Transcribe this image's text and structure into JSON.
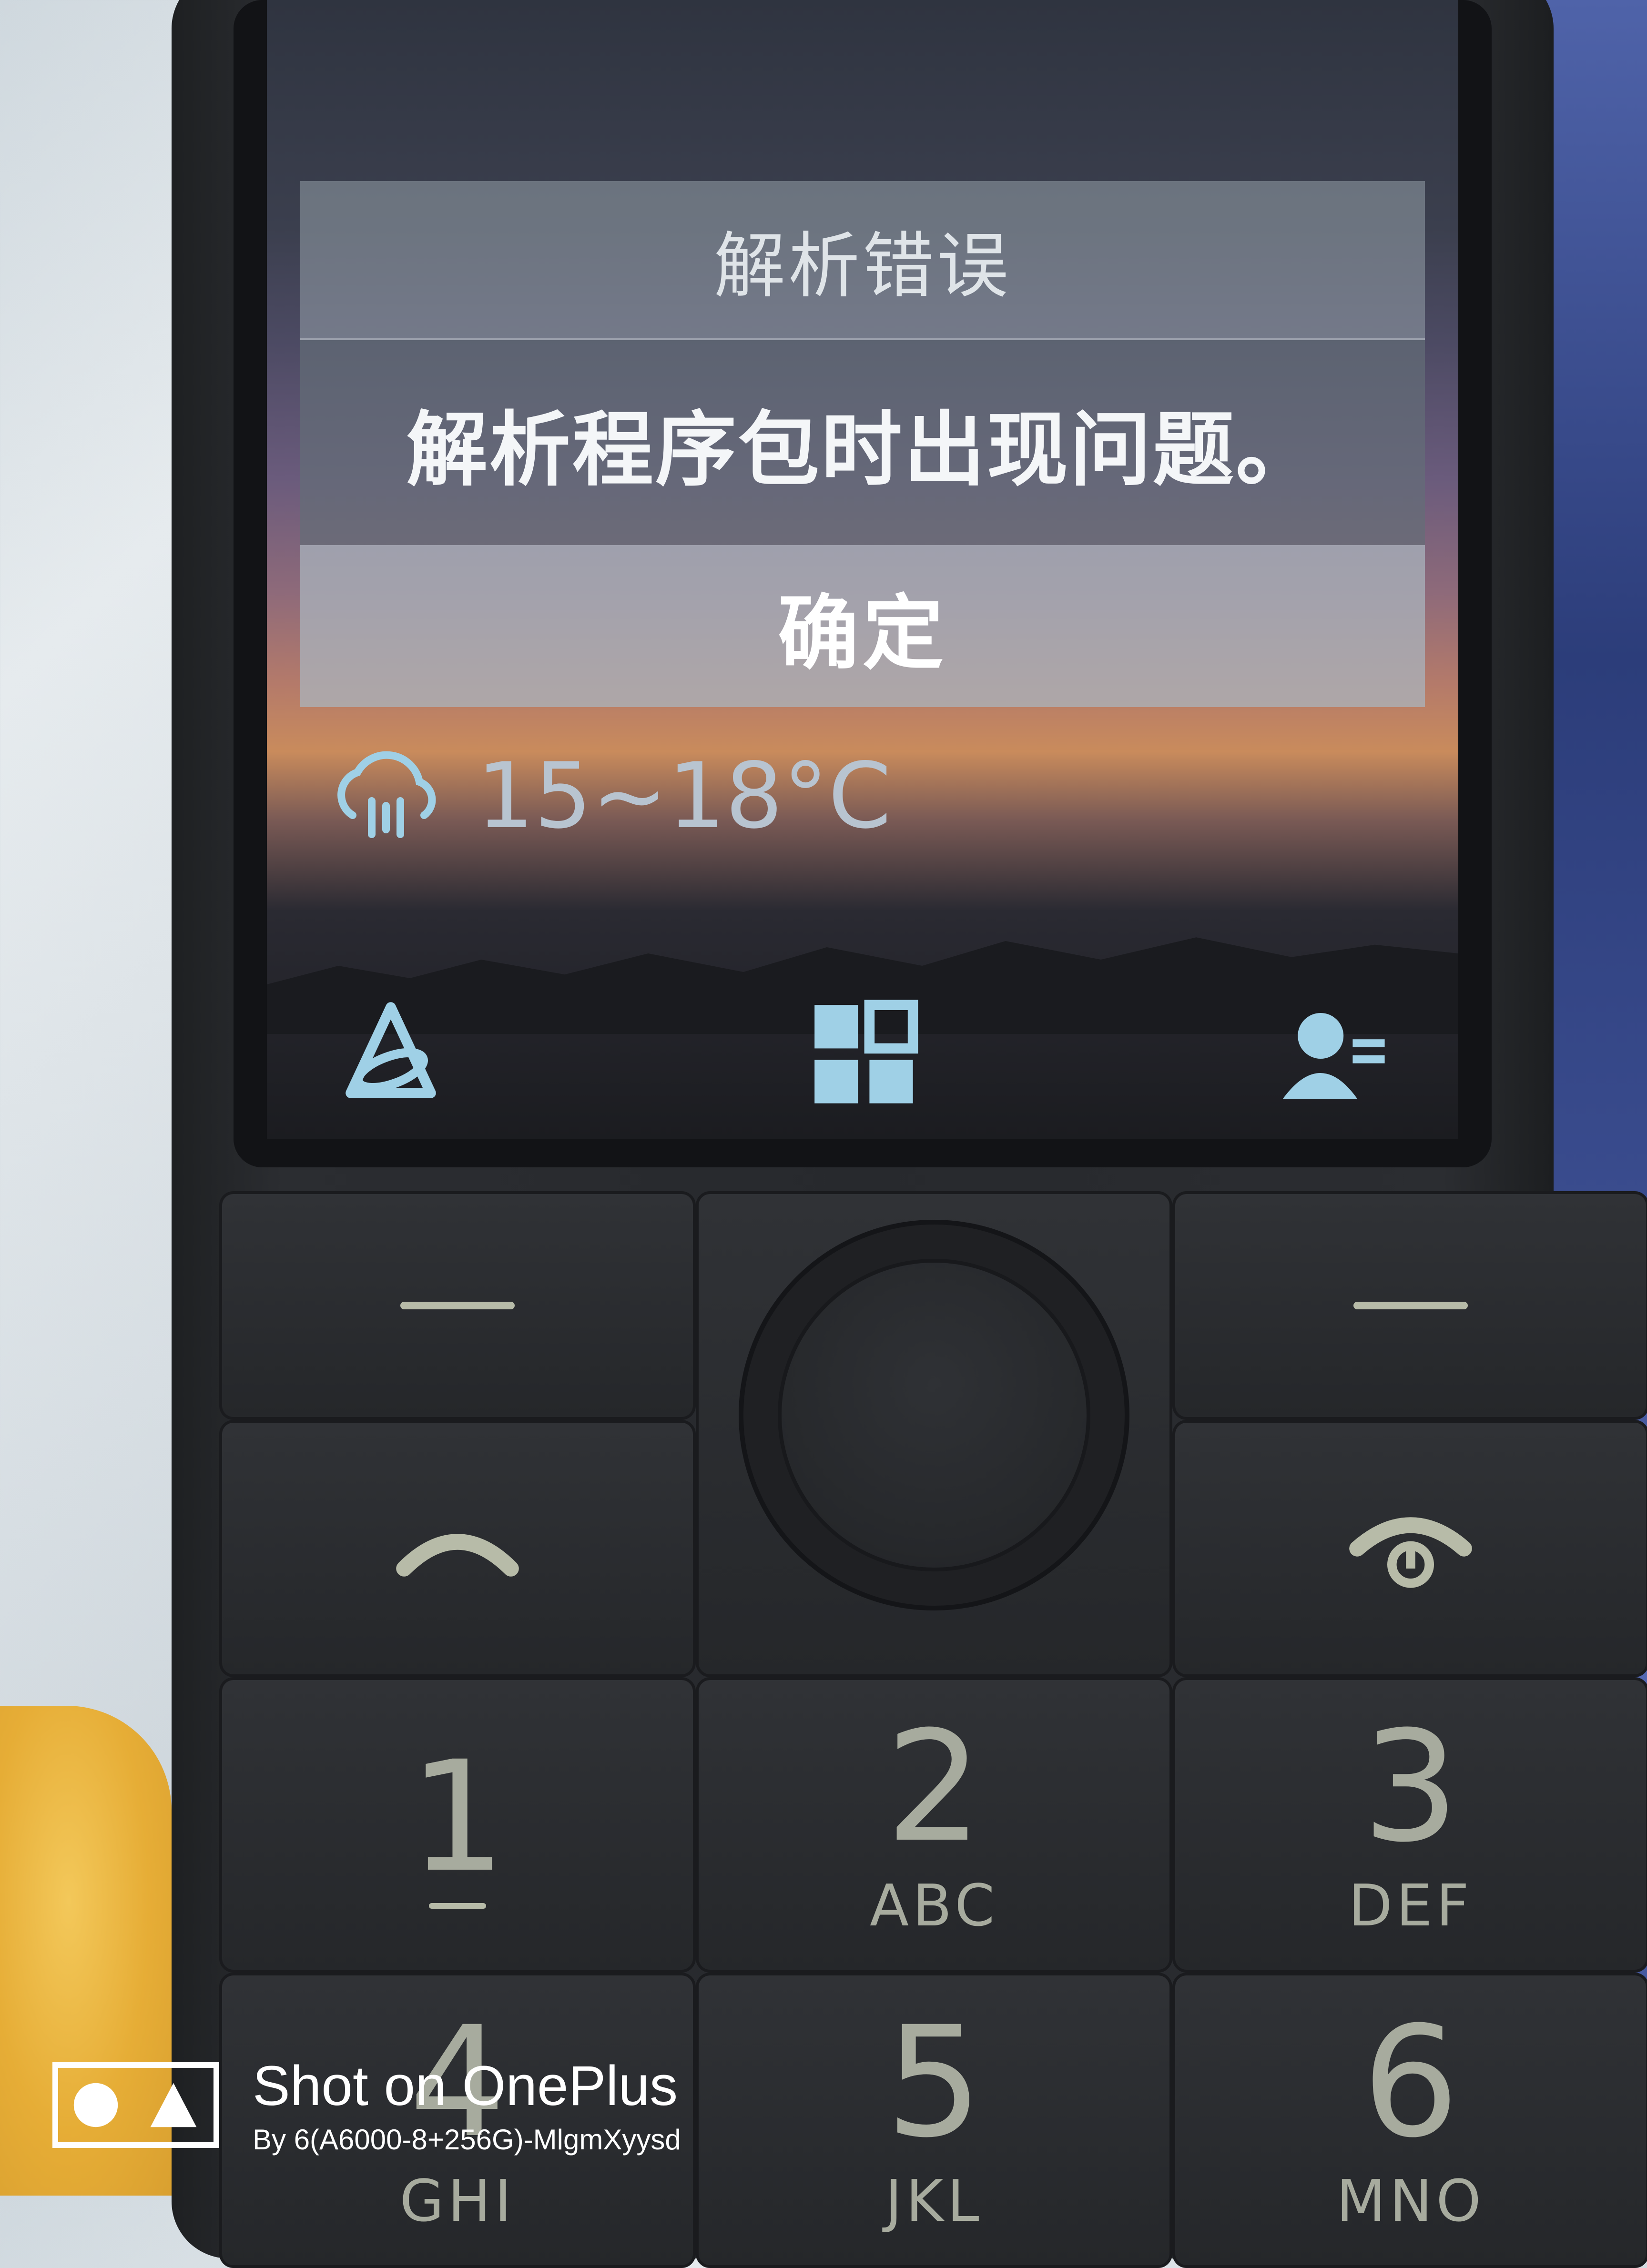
{
  "dialog": {
    "title": "解析错误",
    "message": "解析程序包时出现问题。",
    "ok_label": "确定"
  },
  "weather": {
    "icon": "cloud-rain-icon",
    "temperature": "15~18°C"
  },
  "bottom_bar": {
    "left_icon": "browser-app-icon",
    "center_icon": "app-grid-icon",
    "right_icon": "contacts-icon"
  },
  "keypad": {
    "keys": [
      {
        "digit": "1",
        "letters": ""
      },
      {
        "digit": "2",
        "letters": "ABC"
      },
      {
        "digit": "3",
        "letters": "DEF"
      },
      {
        "digit": "4",
        "letters": "GHI"
      },
      {
        "digit": "5",
        "letters": "JKL"
      },
      {
        "digit": "6",
        "letters": "MNO"
      }
    ]
  },
  "watermark": {
    "title": "Shot on OnePlus",
    "subtitle": "By 6(A6000-8+256G)-MlgmXyysd"
  },
  "colors": {
    "dialog_text": "#ffffff",
    "keypad_text": "#a7ab9e",
    "screen_icon": "#9fd0e6"
  }
}
